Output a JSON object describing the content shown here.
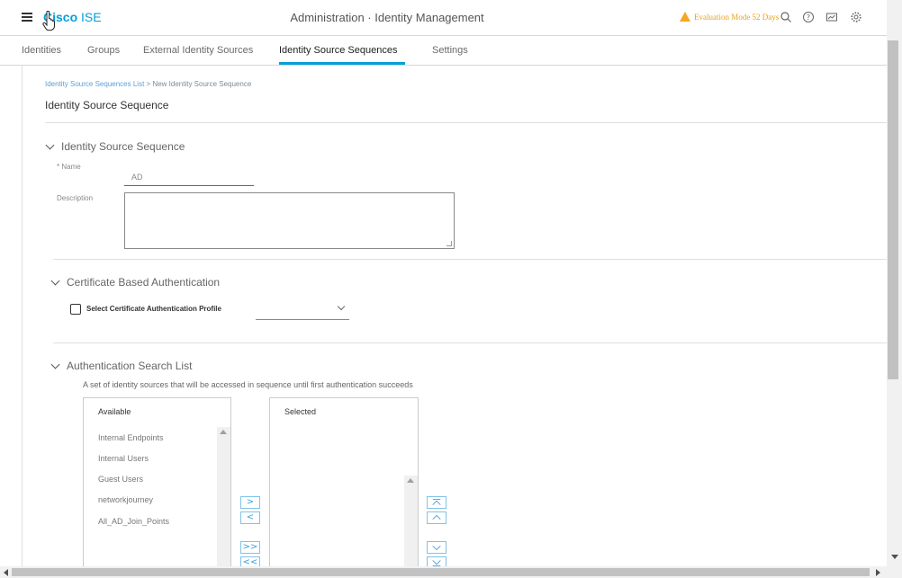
{
  "header": {
    "logo_bold": "Cisco",
    "logo_rest": "ISE",
    "title": "Administration · Identity Management",
    "eval_text": "Evaluation Mode 52 Days",
    "icons": [
      "search-icon",
      "help-icon",
      "dashboard-icon",
      "gear-icon"
    ]
  },
  "tabs": [
    "Identities",
    "Groups",
    "External Identity Sources",
    "Identity Source Sequences",
    "Settings"
  ],
  "breadcrumb": {
    "link": "Identity Source Sequences List",
    "sep": ">",
    "current": "New Identity Source Sequence"
  },
  "page_heading": "Identity Source Sequence",
  "sections": {
    "iss": {
      "title": "Identity Source Sequence",
      "name_label": "* Name",
      "name_value": "AD",
      "description_label": "Description",
      "description_value": ""
    },
    "cert": {
      "title": "Certificate Based Authentication",
      "checkbox_label": "Select Certificate Authentication Profile",
      "select_value": ""
    },
    "search": {
      "title": "Authentication Search List",
      "description": "A set of identity sources that will be accessed in sequence until first authentication succeeds",
      "available_label": "Available",
      "selected_label": "Selected",
      "available_items": [
        "Internal Endpoints",
        "Internal Users",
        "Guest Users",
        "networkjourney",
        "All_AD_Join_Points"
      ],
      "selected_items": [],
      "move_right": ">",
      "move_left": "<",
      "move_all_right": ">>",
      "move_all_left": "<<"
    }
  },
  "colors": {
    "accent": "#049fd9",
    "warning": "#f5a623"
  }
}
